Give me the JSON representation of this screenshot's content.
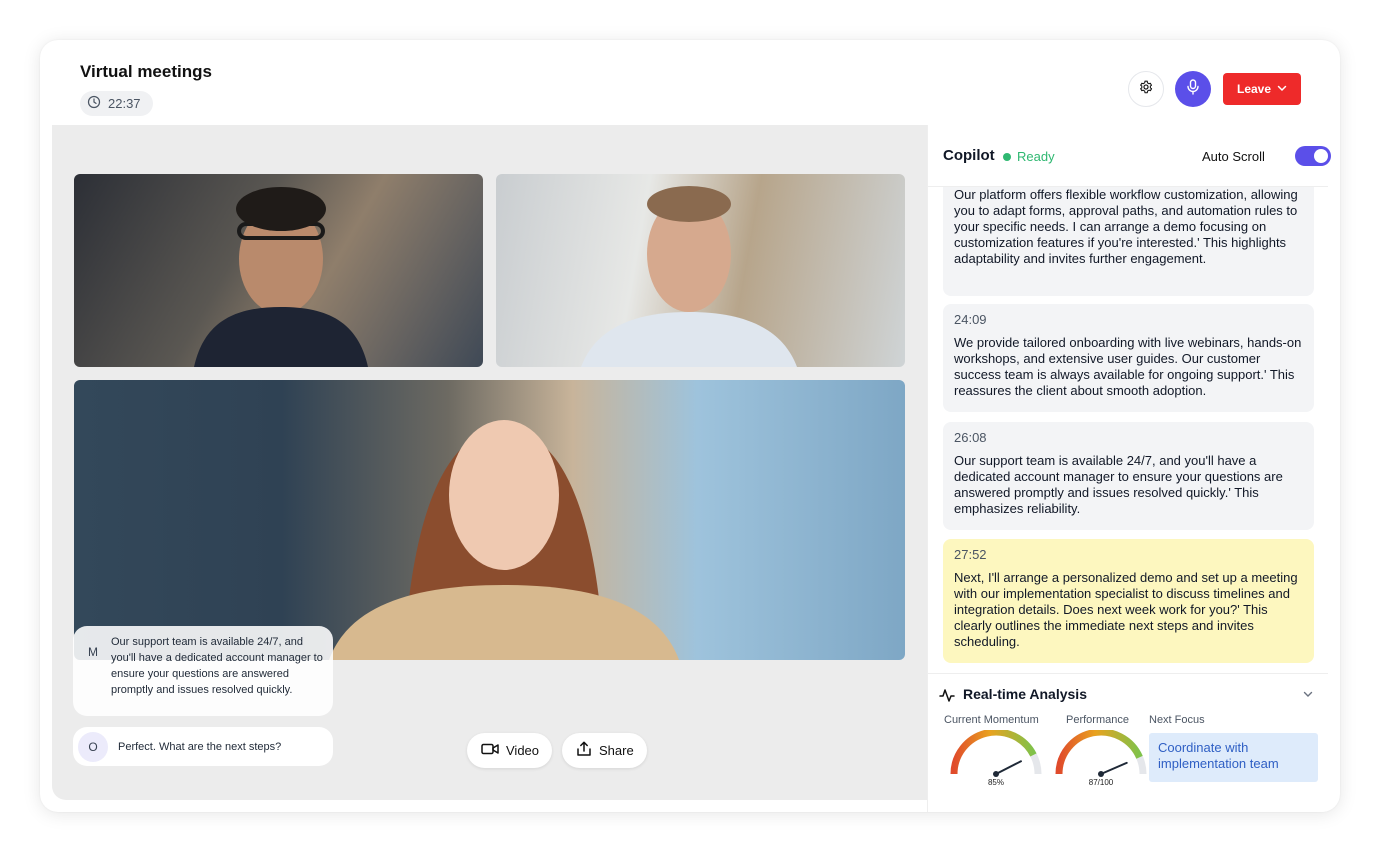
{
  "header": {
    "title": "Virtual meetings",
    "timer": "22:37",
    "leave_label": "Leave",
    "accent_color": "#5b4fe9",
    "leave_color": "#ee2a2a"
  },
  "icons": [
    "clock-icon",
    "gear-icon",
    "microphone-icon",
    "chevron-down-icon",
    "video-camera-icon",
    "share-icon",
    "pulse-icon"
  ],
  "stage": {
    "participants": [
      {
        "id": "tile-1",
        "description_icon": "person-icon"
      },
      {
        "id": "tile-2",
        "description_icon": "person-icon"
      },
      {
        "id": "tile-3",
        "description_icon": "person-icon"
      }
    ],
    "chat": [
      {
        "initial": "M",
        "text": "Our support team is available 24/7, and you'll have a dedicated account manager to ensure your questions are answered promptly and issues resolved quickly."
      },
      {
        "initial": "O",
        "text": "Perfect. What are the next steps?"
      }
    ],
    "controls": {
      "video_label": "Video",
      "share_label": "Share"
    }
  },
  "copilot": {
    "title": "Copilot",
    "status": "Ready",
    "status_color": "#2fb871",
    "auto_scroll_label": "Auto Scroll",
    "auto_scroll_on": true,
    "messages": [
      {
        "time": "",
        "text": "Our platform offers flexible workflow customization, allowing you to adapt forms, approval paths, and automation rules to your specific needs. I can arrange a demo focusing on customization features if you're interested.' This highlights adaptability and invites further engagement.",
        "highlight": false
      },
      {
        "time": "24:09",
        "text": "We provide tailored onboarding with live webinars, hands-on workshops, and extensive user guides. Our customer success team is always available for ongoing support.' This reassures the client about smooth adoption.",
        "highlight": false
      },
      {
        "time": "26:08",
        "text": "Our support team is available 24/7, and you'll have a dedicated account manager to ensure your questions are answered promptly and issues resolved quickly.' This emphasizes reliability.",
        "highlight": false
      },
      {
        "time": "27:52",
        "text": "Next, I'll arrange a personalized demo and set up a meeting with our implementation specialist to discuss timelines and integration details. Does next week work for you?' This clearly outlines the immediate next steps and invites scheduling.",
        "highlight": true
      }
    ]
  },
  "analysis": {
    "title": "Real-time Analysis",
    "momentum_label": "Current Momentum",
    "momentum_value": "85%",
    "momentum_level": 0.85,
    "performance_label": "Performance",
    "performance_value": "87/100",
    "performance_level": 0.87,
    "focus_label": "Next Focus",
    "focus_text": "Coordinate with implementation team"
  }
}
